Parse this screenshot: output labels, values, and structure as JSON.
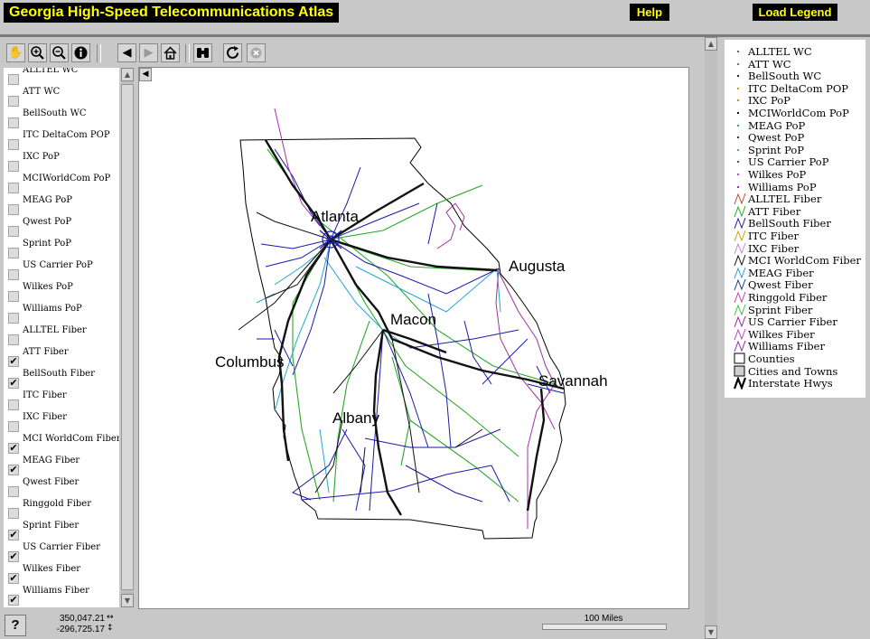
{
  "header": {
    "title": "Georgia High-Speed Telecommunications Atlas",
    "help_label": "Help",
    "load_legend_label": "Load Legend",
    "accent_bg": "#000000",
    "accent_fg": "#ffff00"
  },
  "toolbar": {
    "tools": [
      {
        "name": "pan-tool",
        "icon": "hand-icon"
      },
      {
        "name": "zoom-in-tool",
        "icon": "zoom-in-icon"
      },
      {
        "name": "zoom-out-tool",
        "icon": "zoom-out-icon"
      },
      {
        "name": "identify-tool",
        "icon": "info-icon"
      },
      {
        "name": "back-button",
        "icon": "arrow-left-icon"
      },
      {
        "name": "forward-button",
        "icon": "arrow-right-icon",
        "disabled": true
      },
      {
        "name": "home-button",
        "icon": "home-icon"
      },
      {
        "name": "find-button",
        "icon": "binoculars-icon"
      },
      {
        "name": "refresh-button",
        "icon": "refresh-icon"
      },
      {
        "name": "stop-button",
        "icon": "stop-icon",
        "disabled": true
      }
    ]
  },
  "layers": [
    {
      "label": "ALLTEL WC",
      "checked": false
    },
    {
      "label": "ATT WC",
      "checked": false
    },
    {
      "label": "BellSouth WC",
      "checked": false
    },
    {
      "label": "ITC DeltaCom POP",
      "checked": false
    },
    {
      "label": "IXC PoP",
      "checked": false
    },
    {
      "label": "MCIWorldCom PoP",
      "checked": false
    },
    {
      "label": "MEAG PoP",
      "checked": false
    },
    {
      "label": "Qwest PoP",
      "checked": false
    },
    {
      "label": "Sprint PoP",
      "checked": false
    },
    {
      "label": "US Carrier PoP",
      "checked": false
    },
    {
      "label": "Wilkes PoP",
      "checked": false
    },
    {
      "label": "Williams PoP",
      "checked": false
    },
    {
      "label": "ALLTEL Fiber",
      "checked": false
    },
    {
      "label": "ATT Fiber",
      "checked": true
    },
    {
      "label": "BellSouth Fiber",
      "checked": true
    },
    {
      "label": "ITC Fiber",
      "checked": false
    },
    {
      "label": "IXC Fiber",
      "checked": false
    },
    {
      "label": "MCI WorldCom Fiber",
      "checked": true
    },
    {
      "label": "MEAG Fiber",
      "checked": true
    },
    {
      "label": "Qwest Fiber",
      "checked": false
    },
    {
      "label": "Ringgold Fiber",
      "checked": false
    },
    {
      "label": "Sprint Fiber",
      "checked": true
    },
    {
      "label": "US Carrier Fiber",
      "checked": true
    },
    {
      "label": "Wilkes Fiber",
      "checked": true
    },
    {
      "label": "Williams Fiber",
      "checked": true
    }
  ],
  "map": {
    "cities": [
      "Atlanta",
      "Augusta",
      "Macon",
      "Columbus",
      "Savannah",
      "Albany"
    ]
  },
  "status": {
    "help_label": "?",
    "x_coord": "350,047.21",
    "y_coord": "-296,725.17",
    "scale_label": "100 Miles"
  },
  "legend": [
    {
      "label": "ALLTEL WC",
      "kind": "point",
      "color": "#b84a2a"
    },
    {
      "label": "ATT WC",
      "kind": "point",
      "color": "#22aa22"
    },
    {
      "label": "BellSouth WC",
      "kind": "point",
      "color": "#1a1aa0"
    },
    {
      "label": "ITC DeltaCom POP",
      "kind": "point",
      "color": "#d4a000"
    },
    {
      "label": "IXC PoP",
      "kind": "point",
      "color": "#e08020"
    },
    {
      "label": "MCIWorldCom PoP",
      "kind": "point",
      "color": "#111111"
    },
    {
      "label": "MEAG PoP",
      "kind": "point",
      "color": "#20a0d0"
    },
    {
      "label": "Qwest PoP",
      "kind": "point",
      "color": "#1a3a8a"
    },
    {
      "label": "Sprint PoP",
      "kind": "point",
      "color": "#40c040"
    },
    {
      "label": "US Carrier PoP",
      "kind": "point",
      "color": "#a020a0"
    },
    {
      "label": "Wilkes PoP",
      "kind": "point",
      "color": "#c040c0"
    },
    {
      "label": "Williams PoP",
      "kind": "point",
      "color": "#9030b0"
    },
    {
      "label": "ALLTEL Fiber",
      "kind": "line",
      "color": "#b84a2a"
    },
    {
      "label": "ATT Fiber",
      "kind": "line",
      "color": "#22aa22"
    },
    {
      "label": "BellSouth Fiber",
      "kind": "line",
      "color": "#1a1aa0"
    },
    {
      "label": "ITC Fiber",
      "kind": "line",
      "color": "#d4a000"
    },
    {
      "label": "IXC Fiber",
      "kind": "line",
      "color": "#d080d0"
    },
    {
      "label": "MCI WorldCom Fiber",
      "kind": "line",
      "color": "#111111"
    },
    {
      "label": "MEAG Fiber",
      "kind": "line",
      "color": "#20a0d0"
    },
    {
      "label": "Qwest Fiber",
      "kind": "line",
      "color": "#1a3a8a"
    },
    {
      "label": "Ringgold Fiber",
      "kind": "line",
      "color": "#c040c0"
    },
    {
      "label": "Sprint Fiber",
      "kind": "line",
      "color": "#40c040"
    },
    {
      "label": "US Carrier Fiber",
      "kind": "line",
      "color": "#a020a0"
    },
    {
      "label": "Wilkes Fiber",
      "kind": "line",
      "color": "#c040c0"
    },
    {
      "label": "Williams Fiber",
      "kind": "line",
      "color": "#9030b0"
    },
    {
      "label": "Counties",
      "kind": "box",
      "color": "#000000"
    },
    {
      "label": "Cities and Towns",
      "kind": "dotbox",
      "color": "#000000"
    },
    {
      "label": "Interstate Hwys",
      "kind": "thickline",
      "color": "#000000"
    }
  ]
}
